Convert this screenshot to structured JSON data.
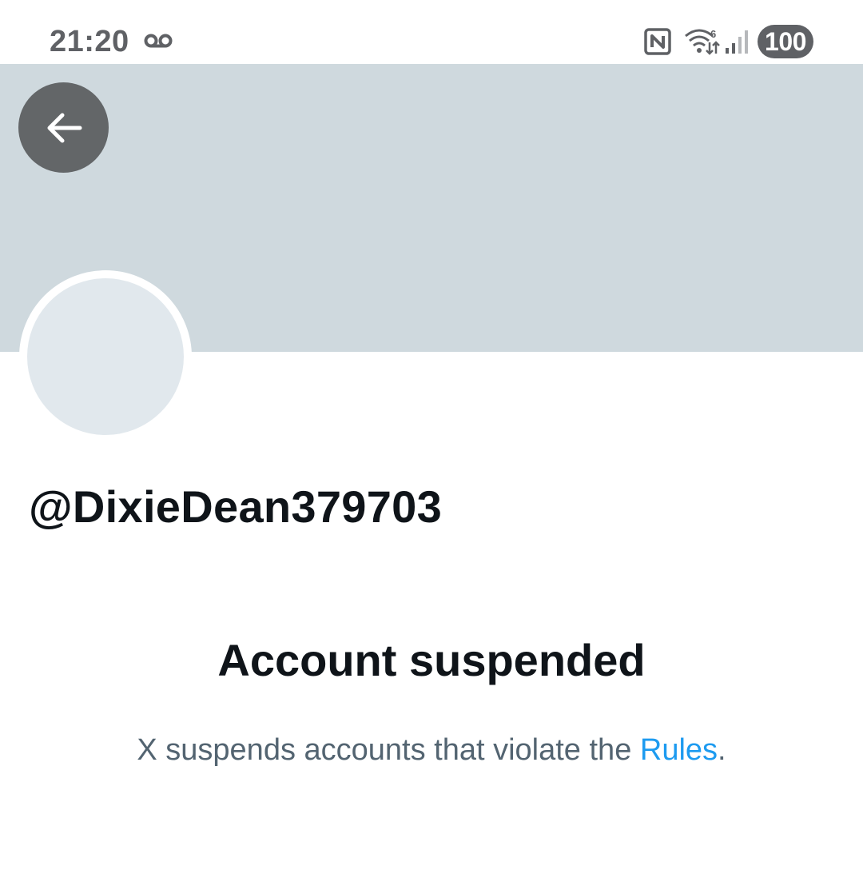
{
  "status_bar": {
    "time": "21:20",
    "battery": "100",
    "icons": [
      "voicemail-icon",
      "nfc-icon",
      "wifi-icon",
      "signal-icon",
      "battery-icon"
    ]
  },
  "profile": {
    "handle": "@DixieDean379703",
    "back_icon": "arrow-left-icon"
  },
  "suspension": {
    "title": "Account suspended",
    "body_prefix": "X suspends accounts that violate the ",
    "link_text": "Rules",
    "body_suffix": "."
  },
  "colors": {
    "banner": "#cfd9de",
    "avatar": "#e1e8ed",
    "back_button": "#636668",
    "primary_text": "#0f1419",
    "secondary_text": "#536471",
    "link": "#1d9bf0"
  }
}
